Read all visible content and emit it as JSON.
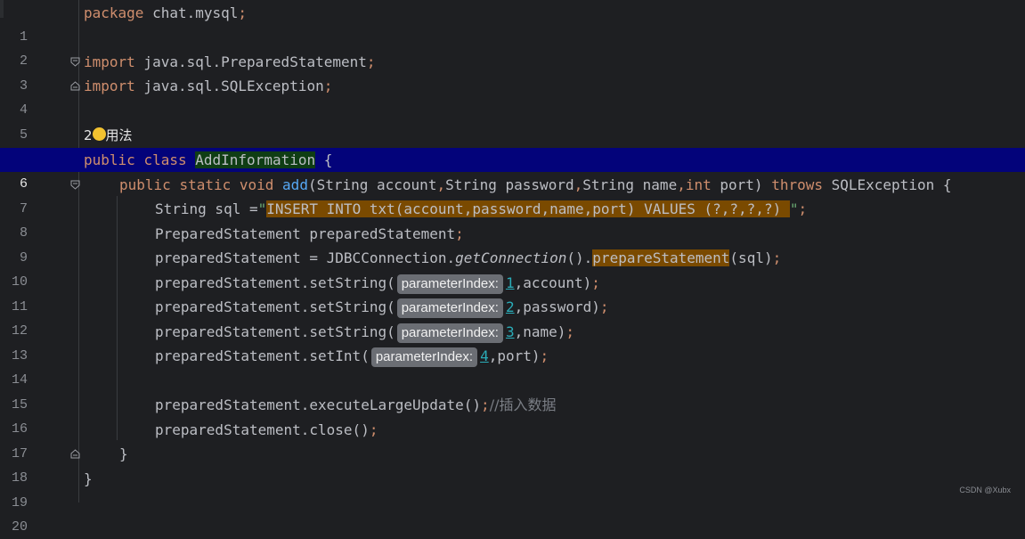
{
  "editor": {
    "lines": [
      {
        "num": "1"
      },
      {
        "num": "2"
      },
      {
        "num": "3"
      },
      {
        "num": "4"
      },
      {
        "num": "5"
      },
      {
        "num": "6"
      },
      {
        "num": "7"
      },
      {
        "num": "8"
      },
      {
        "num": "9"
      },
      {
        "num": "10"
      },
      {
        "num": "11"
      },
      {
        "num": "12"
      },
      {
        "num": "13"
      },
      {
        "num": "14"
      },
      {
        "num": "15"
      },
      {
        "num": "16"
      },
      {
        "num": "17"
      },
      {
        "num": "18"
      },
      {
        "num": "19"
      },
      {
        "num": "20"
      }
    ],
    "usage_hint": {
      "count": "2",
      "label": "用法"
    },
    "tokens": {
      "package_kw": "package",
      "package_name": " chat.mysql",
      "semicolon": ";",
      "import_kw": "import",
      "import1": " java.sql.PreparedStatement",
      "import2": " java.sql.SQLException",
      "public_kw": "public",
      "class_kw": "class",
      "class_name": "AddInformation",
      "brace_open": " {",
      "static_kw": "static",
      "void_kw": "void",
      "method_name": "add",
      "paren_string1": "(String account",
      "comma": ",",
      "string_password": "String password",
      "string_name": "String name",
      "int_kw": "int",
      "port_param": " port) ",
      "throws_kw": "throws",
      "sqlexception": " SQLException {",
      "string_sql": "String sql =",
      "quote_open": "\"",
      "sql_text": "INSERT INTO txt(account,password,name,port) VALUES (?,?,?,?) ",
      "quote_close": "\"",
      "ps_decl": "PreparedStatement preparedStatement",
      "ps_assign": "preparedStatement = JDBCConnection.",
      "get_connection": "getConnection",
      "paren_dot": "().",
      "prepare_statement": "prepareStatement",
      "sql_arg": "(sql)",
      "set_string": "preparedStatement.setString(",
      "set_int": "preparedStatement.setInt(",
      "param_hint": "parameterIndex:",
      "idx1": "1",
      "idx2": "2",
      "idx3": "3",
      "idx4": "4",
      "arg_account": ",account)",
      "arg_password": ",password)",
      "arg_name": ",name)",
      "arg_port": ",port)",
      "execute": "preparedStatement.executeLargeUpdate()",
      "comment": "//插入数据",
      "close": "preparedStatement.close()",
      "close_brace": "}"
    }
  },
  "watermark": "CSDN @Xubx",
  "colors": {
    "background": "#1e1f22",
    "keyword": "#cf8e6d",
    "highlight_line": "#03037a",
    "string_highlight": "#7a4a00",
    "class_highlight": "#0f3d14",
    "number": "#2aacb8"
  }
}
